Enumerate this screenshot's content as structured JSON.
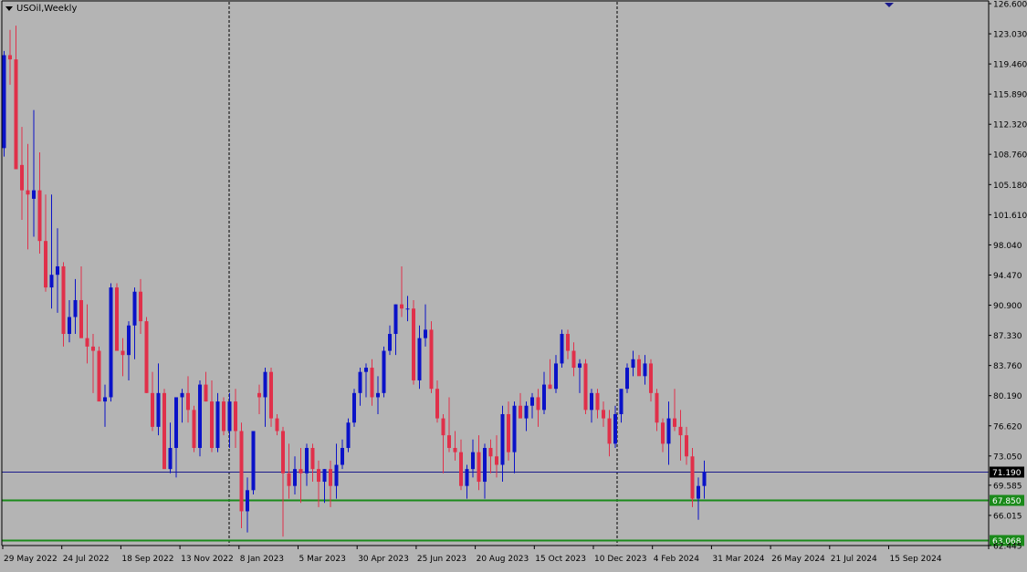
{
  "title": "USOil,Weekly",
  "colors": {
    "background": "#b4b4b4",
    "bull": "#0a12c8",
    "bear": "#e0304a",
    "grid": "#000000",
    "axis_text": "#000000",
    "line_current": "#1a1a8c",
    "line_support": "#1a8a1a"
  },
  "chart_data": {
    "type": "candlestick",
    "title": "USOil,Weekly",
    "ylim": [
      62.4,
      126.6
    ],
    "y_ticks": [
      "126.600",
      "123.030",
      "119.460",
      "115.890",
      "112.320",
      "108.760",
      "105.180",
      "101.610",
      "98.040",
      "94.470",
      "90.900",
      "87.330",
      "83.760",
      "80.190",
      "76.620",
      "73.050",
      "69.585",
      "66.015",
      "62.445"
    ],
    "x_labels": [
      "29 May 2022",
      "24 Jul 2022",
      "18 Sep 2022",
      "13 Nov 2022",
      "8 Jan 2023",
      "5 Mar 2023",
      "30 Apr 2023",
      "25 Jun 2023",
      "20 Aug 2023",
      "15 Oct 2023",
      "10 Dec 2023",
      "4 Feb 2024",
      "31 Mar 2024",
      "26 May 2024",
      "21 Jul 2024",
      "15 Sep 2024"
    ],
    "horizontal_lines": [
      {
        "value": 71.19,
        "label": "71.190",
        "kind": "current"
      },
      {
        "value": 67.85,
        "label": "67.850",
        "kind": "support"
      },
      {
        "value": 63.068,
        "label": "63.068",
        "kind": "support"
      }
    ],
    "period_separators": [
      "8 Jan 2023",
      "10 Dec 2023"
    ],
    "candles": [
      {
        "o": 109.5,
        "h": 121.0,
        "l": 108.5,
        "c": 120.5
      },
      {
        "o": 120.5,
        "h": 123.5,
        "l": 117.0,
        "c": 120.0
      },
      {
        "o": 120.0,
        "h": 124.0,
        "l": 108.0,
        "c": 107.0
      },
      {
        "o": 107.5,
        "h": 112.0,
        "l": 101.0,
        "c": 104.5
      },
      {
        "o": 104.5,
        "h": 110.0,
        "l": 97.5,
        "c": 104.0
      },
      {
        "o": 103.5,
        "h": 114.0,
        "l": 99.0,
        "c": 104.5
      },
      {
        "o": 104.5,
        "h": 109.0,
        "l": 97.0,
        "c": 98.5
      },
      {
        "o": 98.5,
        "h": 104.0,
        "l": 92.5,
        "c": 93.0
      },
      {
        "o": 93.0,
        "h": 104.0,
        "l": 90.5,
        "c": 94.5
      },
      {
        "o": 94.5,
        "h": 100.0,
        "l": 90.0,
        "c": 95.5
      },
      {
        "o": 95.5,
        "h": 96.0,
        "l": 86.0,
        "c": 87.5
      },
      {
        "o": 87.5,
        "h": 91.5,
        "l": 86.5,
        "c": 89.5
      },
      {
        "o": 89.5,
        "h": 94.0,
        "l": 87.5,
        "c": 91.5
      },
      {
        "o": 91.5,
        "h": 95.5,
        "l": 87.0,
        "c": 87.0
      },
      {
        "o": 87.0,
        "h": 91.0,
        "l": 84.0,
        "c": 86.0
      },
      {
        "o": 86.0,
        "h": 87.5,
        "l": 80.5,
        "c": 85.5
      },
      {
        "o": 85.5,
        "h": 86.0,
        "l": 80.0,
        "c": 79.5
      },
      {
        "o": 79.5,
        "h": 81.5,
        "l": 76.5,
        "c": 80.0
      },
      {
        "o": 80.0,
        "h": 93.5,
        "l": 79.5,
        "c": 93.0
      },
      {
        "o": 93.0,
        "h": 93.5,
        "l": 85.5,
        "c": 85.5
      },
      {
        "o": 85.5,
        "h": 87.0,
        "l": 82.5,
        "c": 85.0
      },
      {
        "o": 85.0,
        "h": 89.0,
        "l": 82.0,
        "c": 88.5
      },
      {
        "o": 88.5,
        "h": 93.0,
        "l": 84.5,
        "c": 92.5
      },
      {
        "o": 92.5,
        "h": 94.0,
        "l": 87.5,
        "c": 89.0
      },
      {
        "o": 89.0,
        "h": 89.5,
        "l": 80.5,
        "c": 80.5
      },
      {
        "o": 80.5,
        "h": 83.0,
        "l": 76.0,
        "c": 76.5
      },
      {
        "o": 76.5,
        "h": 84.0,
        "l": 75.5,
        "c": 80.5
      },
      {
        "o": 80.5,
        "h": 81.0,
        "l": 71.5,
        "c": 71.5
      },
      {
        "o": 71.5,
        "h": 77.0,
        "l": 71.0,
        "c": 74.0
      },
      {
        "o": 74.0,
        "h": 80.0,
        "l": 70.5,
        "c": 80.0
      },
      {
        "o": 80.0,
        "h": 81.0,
        "l": 77.0,
        "c": 80.5
      },
      {
        "o": 80.5,
        "h": 82.5,
        "l": 77.0,
        "c": 78.5
      },
      {
        "o": 78.5,
        "h": 79.0,
        "l": 73.5,
        "c": 74.0
      },
      {
        "o": 74.0,
        "h": 82.0,
        "l": 73.0,
        "c": 81.5
      },
      {
        "o": 81.5,
        "h": 83.0,
        "l": 79.5,
        "c": 79.5
      },
      {
        "o": 79.5,
        "h": 82.0,
        "l": 73.5,
        "c": 74.0
      },
      {
        "o": 74.0,
        "h": 80.5,
        "l": 73.5,
        "c": 79.5
      },
      {
        "o": 79.5,
        "h": 80.0,
        "l": 75.5,
        "c": 76.0
      },
      {
        "o": 76.0,
        "h": 80.5,
        "l": 74.0,
        "c": 79.5
      },
      {
        "o": 79.5,
        "h": 81.0,
        "l": 74.0,
        "c": 76.0
      },
      {
        "o": 76.0,
        "h": 77.0,
        "l": 64.5,
        "c": 66.5
      },
      {
        "o": 66.5,
        "h": 70.5,
        "l": 64.0,
        "c": 69.0
      },
      {
        "o": 69.0,
        "h": 76.0,
        "l": 68.5,
        "c": 76.0
      },
      {
        "o": 80.5,
        "h": 81.5,
        "l": 78.0,
        "c": 80.0
      },
      {
        "o": 80.0,
        "h": 83.5,
        "l": 76.5,
        "c": 83.0
      },
      {
        "o": 83.0,
        "h": 83.5,
        "l": 76.5,
        "c": 77.5
      },
      {
        "o": 77.5,
        "h": 78.0,
        "l": 75.5,
        "c": 76.0
      },
      {
        "o": 76.0,
        "h": 76.5,
        "l": 63.5,
        "c": 71.0
      },
      {
        "o": 71.0,
        "h": 74.5,
        "l": 68.0,
        "c": 69.5
      },
      {
        "o": 69.5,
        "h": 73.0,
        "l": 68.5,
        "c": 71.5
      },
      {
        "o": 71.5,
        "h": 74.0,
        "l": 67.5,
        "c": 71.0
      },
      {
        "o": 71.0,
        "h": 74.5,
        "l": 69.5,
        "c": 74.0
      },
      {
        "o": 74.0,
        "h": 74.5,
        "l": 70.0,
        "c": 71.5
      },
      {
        "o": 71.5,
        "h": 72.5,
        "l": 67.0,
        "c": 70.0
      },
      {
        "o": 70.0,
        "h": 71.5,
        "l": 67.5,
        "c": 71.5
      },
      {
        "o": 71.5,
        "h": 72.5,
        "l": 67.0,
        "c": 69.5
      },
      {
        "o": 69.5,
        "h": 74.5,
        "l": 68.0,
        "c": 72.0
      },
      {
        "o": 72.0,
        "h": 75.0,
        "l": 71.5,
        "c": 74.0
      },
      {
        "o": 74.0,
        "h": 77.5,
        "l": 73.5,
        "c": 77.0
      },
      {
        "o": 77.0,
        "h": 81.0,
        "l": 76.5,
        "c": 80.5
      },
      {
        "o": 80.5,
        "h": 83.5,
        "l": 79.0,
        "c": 83.0
      },
      {
        "o": 83.0,
        "h": 84.0,
        "l": 80.0,
        "c": 83.5
      },
      {
        "o": 83.5,
        "h": 84.5,
        "l": 79.0,
        "c": 80.0
      },
      {
        "o": 80.0,
        "h": 82.5,
        "l": 78.0,
        "c": 80.5
      },
      {
        "o": 80.5,
        "h": 86.0,
        "l": 80.0,
        "c": 85.5
      },
      {
        "o": 85.5,
        "h": 88.5,
        "l": 85.0,
        "c": 87.5
      },
      {
        "o": 87.5,
        "h": 91.0,
        "l": 85.0,
        "c": 91.0
      },
      {
        "o": 91.0,
        "h": 95.5,
        "l": 89.5,
        "c": 90.5
      },
      {
        "o": 90.5,
        "h": 92.0,
        "l": 89.0,
        "c": 90.5
      },
      {
        "o": 90.5,
        "h": 91.5,
        "l": 81.5,
        "c": 82.0
      },
      {
        "o": 82.0,
        "h": 88.5,
        "l": 81.0,
        "c": 87.0
      },
      {
        "o": 87.0,
        "h": 91.0,
        "l": 86.0,
        "c": 88.0
      },
      {
        "o": 88.0,
        "h": 89.0,
        "l": 80.5,
        "c": 81.0
      },
      {
        "o": 81.0,
        "h": 82.0,
        "l": 77.0,
        "c": 77.5
      },
      {
        "o": 77.5,
        "h": 78.0,
        "l": 71.0,
        "c": 75.5
      },
      {
        "o": 75.5,
        "h": 80.0,
        "l": 73.5,
        "c": 74.0
      },
      {
        "o": 74.0,
        "h": 76.0,
        "l": 72.5,
        "c": 73.5
      },
      {
        "o": 73.5,
        "h": 75.0,
        "l": 69.0,
        "c": 69.5
      },
      {
        "o": 69.5,
        "h": 72.0,
        "l": 68.0,
        "c": 71.5
      },
      {
        "o": 71.5,
        "h": 75.0,
        "l": 70.5,
        "c": 73.5
      },
      {
        "o": 73.5,
        "h": 75.5,
        "l": 69.0,
        "c": 70.0
      },
      {
        "o": 70.0,
        "h": 74.5,
        "l": 68.0,
        "c": 74.0
      },
      {
        "o": 74.0,
        "h": 75.0,
        "l": 71.0,
        "c": 73.0
      },
      {
        "o": 73.0,
        "h": 75.5,
        "l": 70.5,
        "c": 72.0
      },
      {
        "o": 72.0,
        "h": 79.0,
        "l": 70.0,
        "c": 78.0
      },
      {
        "o": 78.0,
        "h": 79.5,
        "l": 72.5,
        "c": 73.5
      },
      {
        "o": 73.5,
        "h": 79.5,
        "l": 71.0,
        "c": 79.0
      },
      {
        "o": 79.0,
        "h": 80.5,
        "l": 77.5,
        "c": 77.5
      },
      {
        "o": 77.5,
        "h": 79.5,
        "l": 76.0,
        "c": 79.0
      },
      {
        "o": 79.0,
        "h": 80.5,
        "l": 77.5,
        "c": 80.0
      },
      {
        "o": 80.0,
        "h": 81.0,
        "l": 76.5,
        "c": 78.5
      },
      {
        "o": 78.5,
        "h": 83.0,
        "l": 78.0,
        "c": 81.5
      },
      {
        "o": 81.5,
        "h": 84.5,
        "l": 81.0,
        "c": 81.0
      },
      {
        "o": 81.0,
        "h": 85.0,
        "l": 80.5,
        "c": 84.0
      },
      {
        "o": 84.0,
        "h": 88.0,
        "l": 83.5,
        "c": 87.5
      },
      {
        "o": 87.5,
        "h": 88.0,
        "l": 84.5,
        "c": 85.5
      },
      {
        "o": 85.5,
        "h": 86.5,
        "l": 82.5,
        "c": 83.5
      },
      {
        "o": 83.5,
        "h": 84.5,
        "l": 80.5,
        "c": 84.0
      },
      {
        "o": 84.0,
        "h": 84.5,
        "l": 78.0,
        "c": 78.5
      },
      {
        "o": 78.5,
        "h": 81.0,
        "l": 77.0,
        "c": 80.5
      },
      {
        "o": 80.5,
        "h": 81.0,
        "l": 77.5,
        "c": 78.5
      },
      {
        "o": 78.5,
        "h": 79.5,
        "l": 76.5,
        "c": 77.5
      },
      {
        "o": 77.5,
        "h": 78.5,
        "l": 73.0,
        "c": 74.5
      },
      {
        "o": 74.5,
        "h": 79.0,
        "l": 74.0,
        "c": 78.0
      },
      {
        "o": 78.0,
        "h": 80.5,
        "l": 77.0,
        "c": 81.0
      },
      {
        "o": 81.0,
        "h": 84.0,
        "l": 80.5,
        "c": 83.5
      },
      {
        "o": 83.5,
        "h": 85.5,
        "l": 82.5,
        "c": 84.5
      },
      {
        "o": 84.5,
        "h": 85.0,
        "l": 83.0,
        "c": 82.5
      },
      {
        "o": 82.5,
        "h": 85.0,
        "l": 81.5,
        "c": 84.0
      },
      {
        "o": 84.0,
        "h": 84.5,
        "l": 79.5,
        "c": 80.5
      },
      {
        "o": 80.5,
        "h": 81.0,
        "l": 76.0,
        "c": 77.0
      },
      {
        "o": 77.0,
        "h": 77.5,
        "l": 73.5,
        "c": 74.5
      },
      {
        "o": 74.5,
        "h": 79.5,
        "l": 72.0,
        "c": 77.5
      },
      {
        "o": 77.5,
        "h": 81.0,
        "l": 76.0,
        "c": 76.5
      },
      {
        "o": 76.5,
        "h": 78.5,
        "l": 72.5,
        "c": 75.5
      },
      {
        "o": 75.5,
        "h": 76.5,
        "l": 72.0,
        "c": 73.0
      },
      {
        "o": 73.0,
        "h": 74.0,
        "l": 67.0,
        "c": 68.0
      },
      {
        "o": 68.0,
        "h": 70.5,
        "l": 65.5,
        "c": 69.5
      },
      {
        "o": 69.5,
        "h": 72.5,
        "l": 68.0,
        "c": 71.2
      }
    ]
  }
}
